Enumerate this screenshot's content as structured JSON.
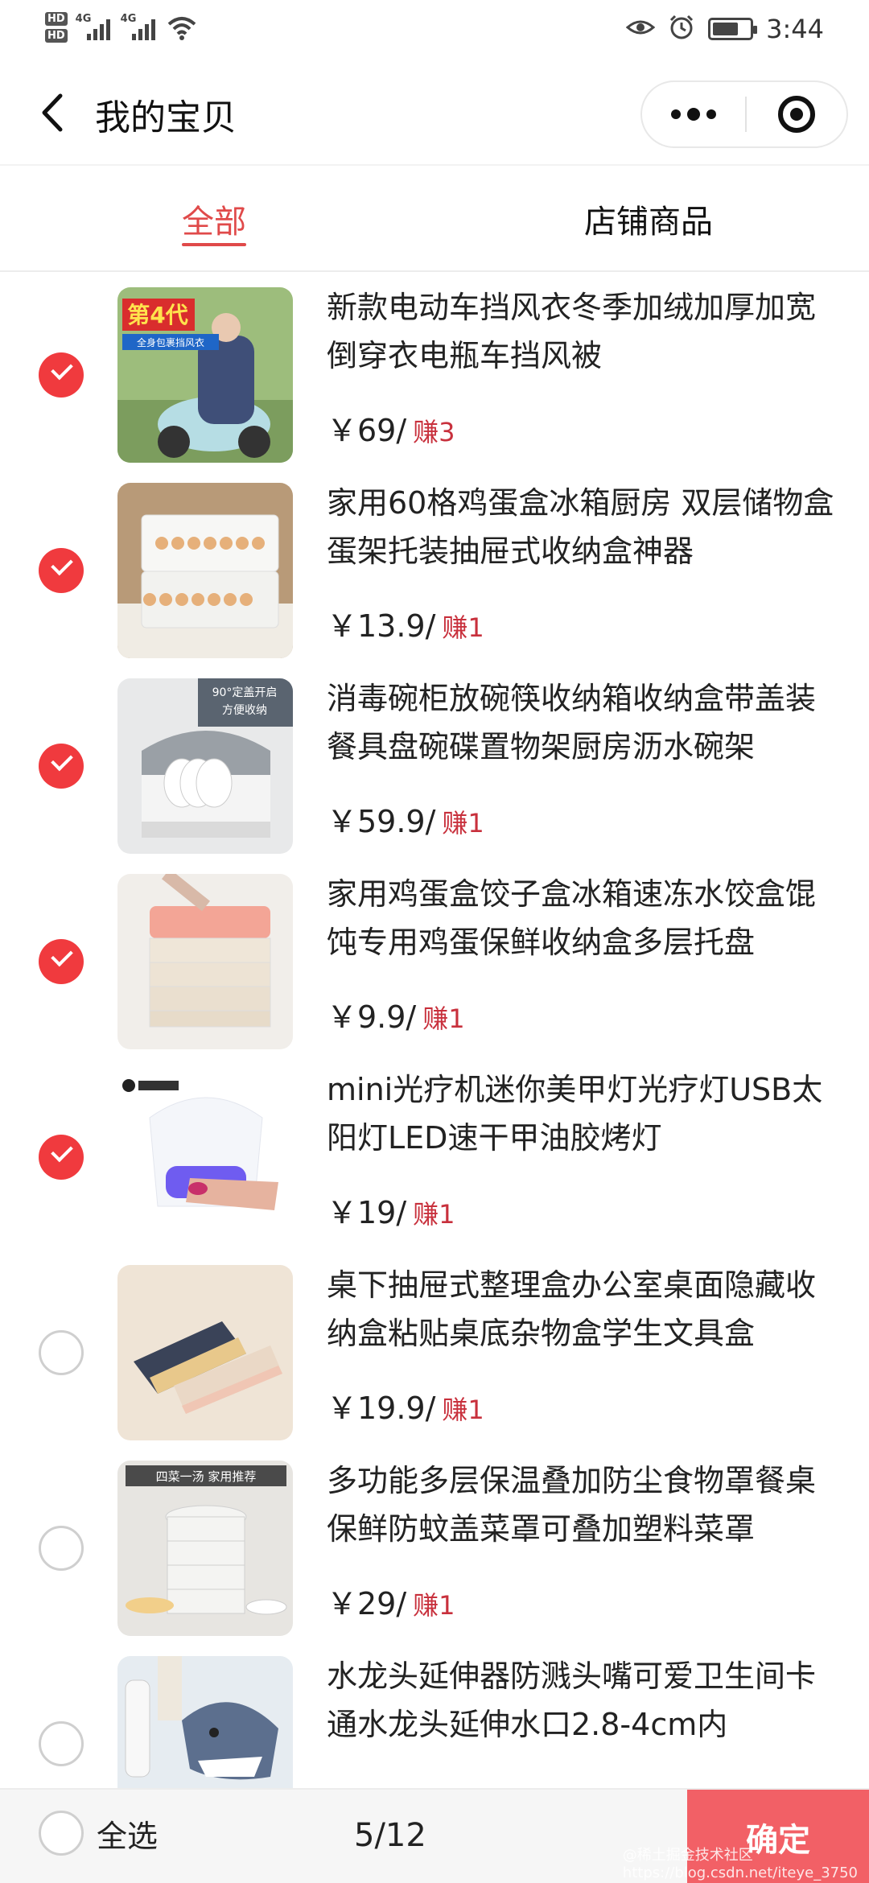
{
  "status_bar": {
    "hd_badges": [
      "HD",
      "HD"
    ],
    "network_1": "4G",
    "network_2": "4G",
    "time": "3:44",
    "battery_level": 0.7
  },
  "header": {
    "title": "我的宝贝"
  },
  "tabs": [
    {
      "label": "全部",
      "active": true
    },
    {
      "label": "店铺商品",
      "active": false
    }
  ],
  "items": [
    {
      "title": "新款电动车挡风衣冬季加绒加厚加宽倒穿衣电瓶车挡风被",
      "price": "￥69/",
      "earn": "赚3",
      "selected": true,
      "thumb_text": [
        "第4代",
        "全身包裹挡风衣"
      ]
    },
    {
      "title": "家用60格鸡蛋盒冰箱厨房 双层储物盒蛋架托装抽屉式收纳盒神器",
      "price": "￥13.9/",
      "earn": "赚1",
      "selected": true
    },
    {
      "title": "消毒碗柜放碗筷收纳箱收纳盒带盖装餐具盘碗碟置物架厨房沥水碗架",
      "price": "￥59.9/",
      "earn": "赚1",
      "selected": true,
      "thumb_text": [
        "90°定盖开启",
        "方便收纳"
      ]
    },
    {
      "title": "家用鸡蛋盒饺子盒冰箱速冻水饺盒馄饨专用鸡蛋保鲜收纳盒多层托盘",
      "price": "￥9.9/",
      "earn": "赚1",
      "selected": true
    },
    {
      "title": "mini光疗机迷你美甲灯光疗灯USB太阳灯LED速干甲油胶烤灯",
      "price": "￥19/",
      "earn": "赚1",
      "selected": true
    },
    {
      "title": "桌下抽屉式整理盒办公室桌面隐藏收纳盒粘贴桌底杂物盒学生文具盒",
      "price": "￥19.9/",
      "earn": "赚1",
      "selected": false
    },
    {
      "title": "多功能多层保温叠加防尘食物罩餐桌保鲜防蚊盖菜罩可叠加塑料菜罩",
      "price": "￥29/",
      "earn": "赚1",
      "selected": false,
      "thumb_text": [
        "四菜一汤 家用推荐"
      ]
    },
    {
      "title": "水龙头延伸器防溅头嘴可爱卫生间卡通水龙头延伸水口2.8-4cm内",
      "price": "",
      "earn": "",
      "selected": false
    }
  ],
  "footer": {
    "select_all_label": "全选",
    "count": "5/12",
    "confirm_label": "确定",
    "watermark": "@稀土掘金技术社区 https://blog.csdn.net/iteye_3750"
  },
  "colors": {
    "accent": "#e04a4a",
    "check": "#f03a3e",
    "earn": "#c8303c",
    "confirm_bg": "#f26066"
  }
}
